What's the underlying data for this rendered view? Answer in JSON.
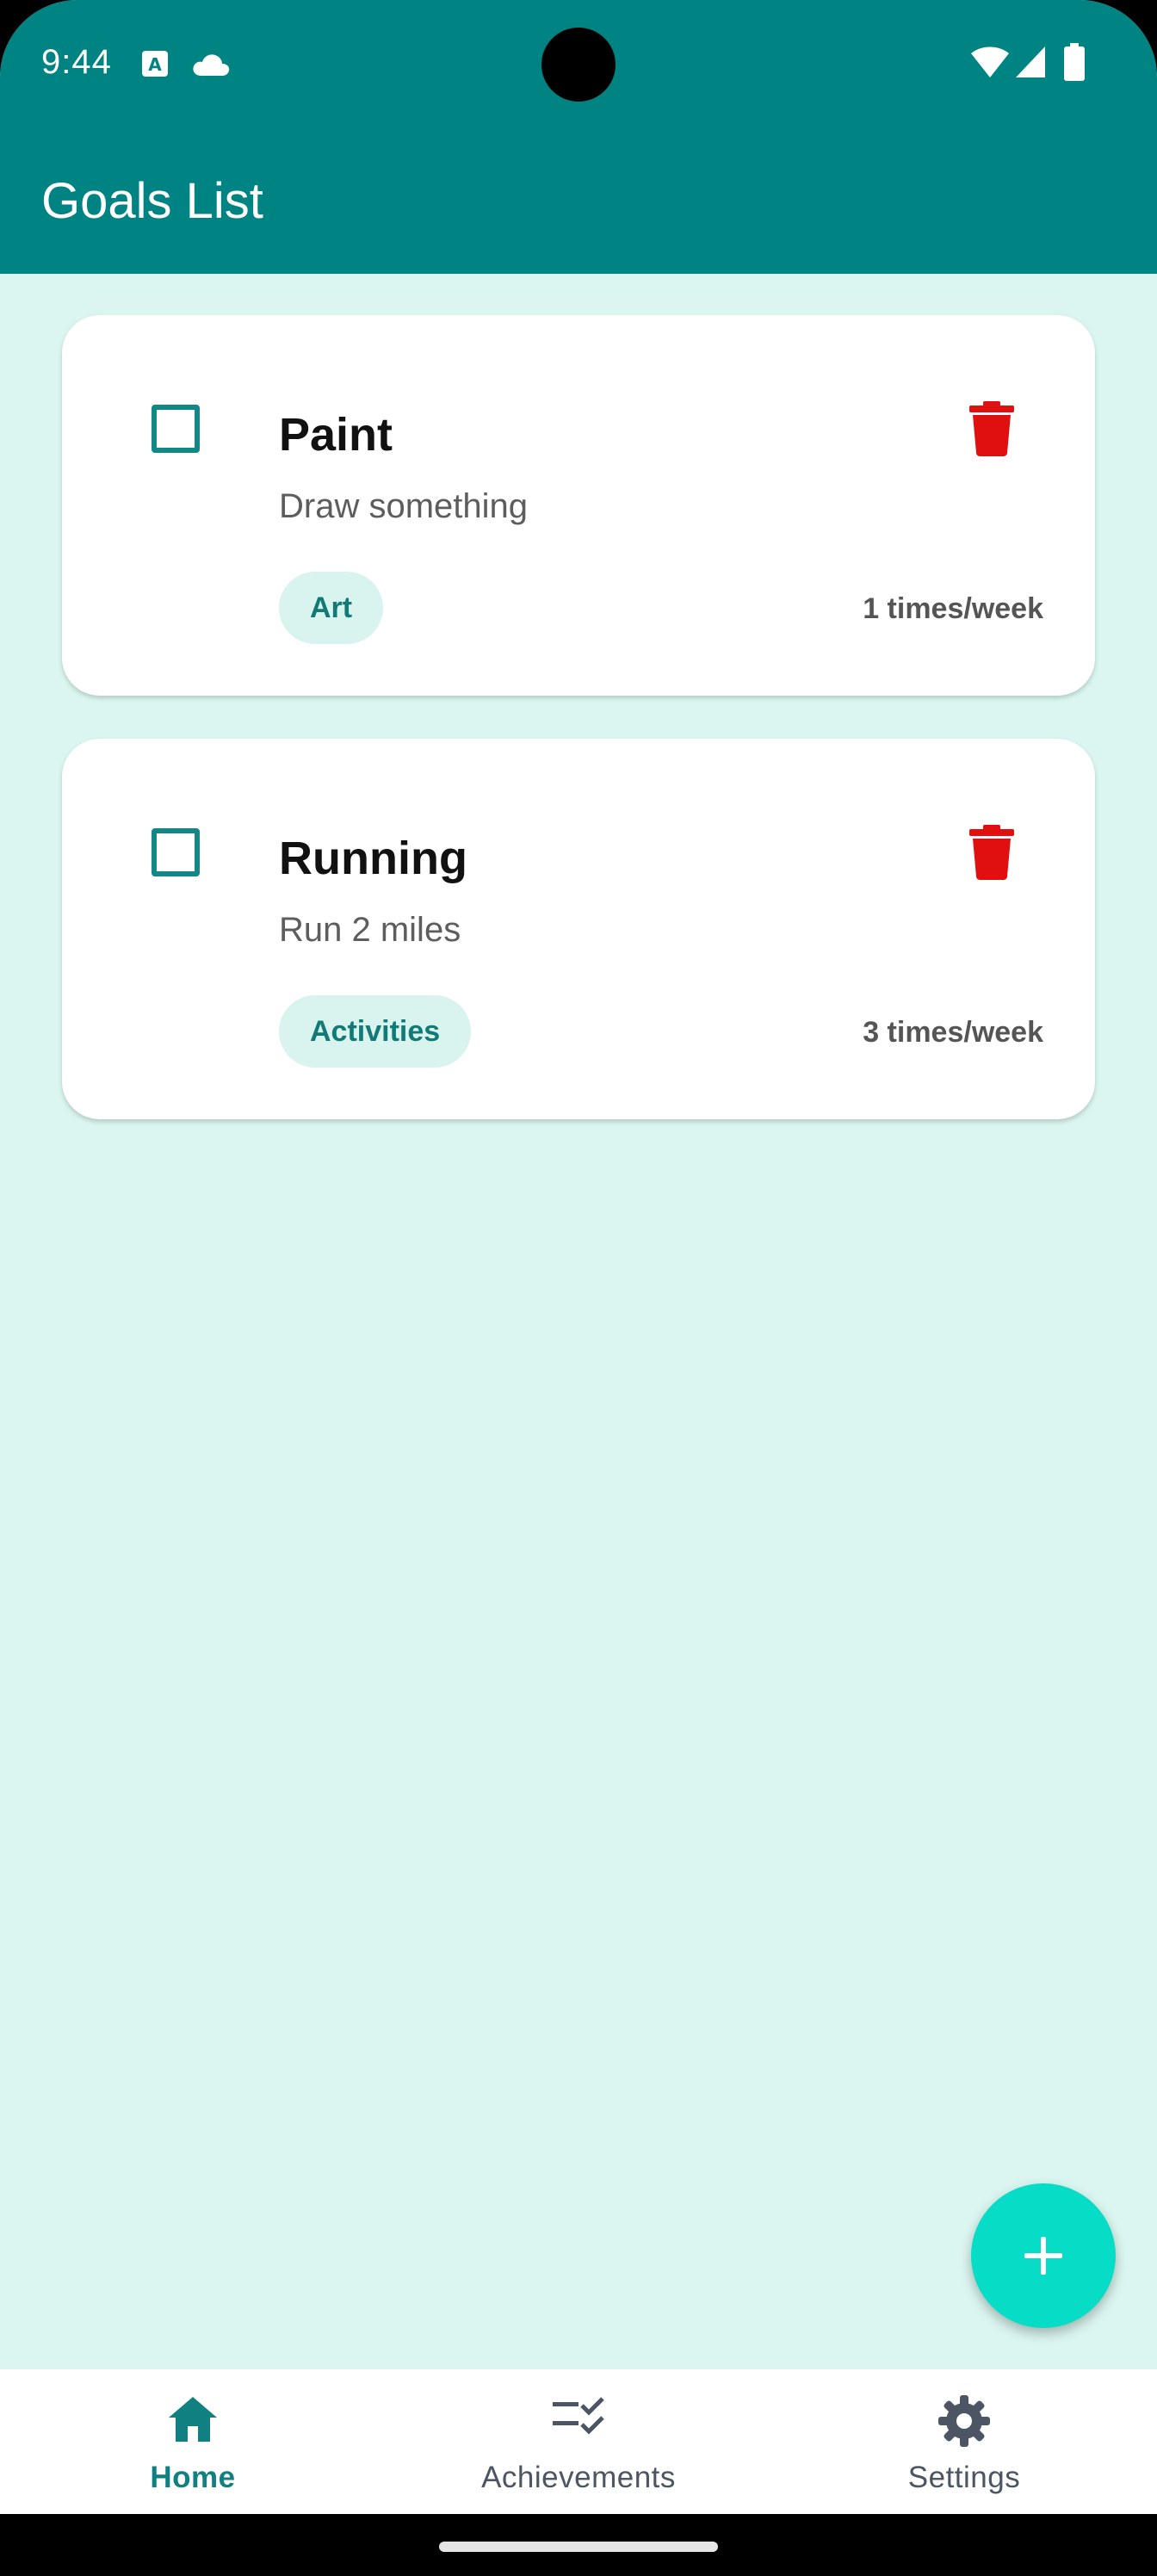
{
  "status_bar": {
    "time": "9:44",
    "icons": [
      "a-notification-icon",
      "cloud-icon",
      "wifi-icon",
      "signal-icon",
      "battery-icon"
    ]
  },
  "app_bar": {
    "title": "Goals List"
  },
  "goals": [
    {
      "title": "Paint",
      "description": "Draw something",
      "category": "Art",
      "frequency": "1 times/week",
      "checked": false
    },
    {
      "title": "Running",
      "description": "Run 2 miles",
      "category": "Activities",
      "frequency": "3 times/week",
      "checked": false
    }
  ],
  "fab": {
    "icon": "plus-icon"
  },
  "bottom_nav": {
    "items": [
      {
        "label": "Home",
        "icon": "home-icon",
        "active": true
      },
      {
        "label": "Achievements",
        "icon": "checklist-icon",
        "active": false
      },
      {
        "label": "Settings",
        "icon": "gear-icon",
        "active": false
      }
    ]
  },
  "colors": {
    "primary": "#008383",
    "background": "#dbf6f0",
    "fab": "#07dcc7",
    "delete": "#e01010",
    "tag_bg": "#d9f4ee"
  }
}
